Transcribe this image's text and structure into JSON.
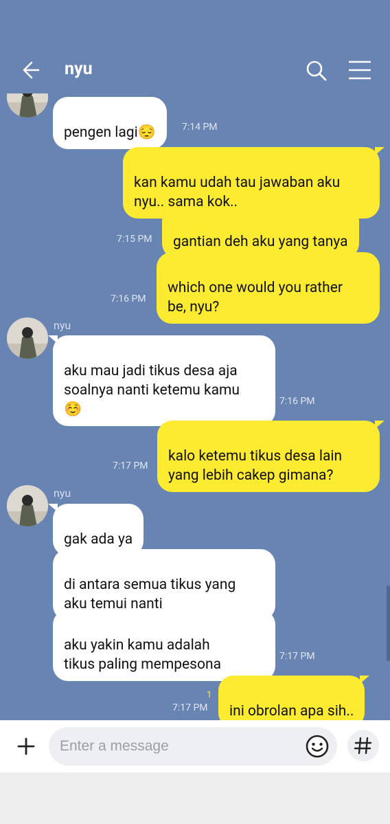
{
  "header": {
    "title": "nyu"
  },
  "messages": [
    {
      "text": "pengen lagi😔",
      "time": "7:14 PM"
    },
    {
      "text": "kan kamu udah tau jawaban aku\nnyu.. sama kok.."
    },
    {
      "text": "gantian deh aku yang tanya",
      "time": "7:15 PM"
    },
    {
      "text": "which one would you rather\nbe, nyu?",
      "time": "7:16 PM"
    },
    {
      "sender": "nyu",
      "text": "aku mau jadi tikus desa aja\nsoalnya nanti ketemu kamu\n☺️",
      "time": "7:16 PM"
    },
    {
      "text": "kalo ketemu tikus desa lain\nyang lebih cakep gimana?",
      "time": "7:17 PM"
    },
    {
      "sender": "nyu",
      "text": "gak ada ya"
    },
    {
      "text": "di antara semua tikus yang\naku temui nanti"
    },
    {
      "text": "aku yakin kamu adalah\ntikus paling mempesona",
      "time": "7:17 PM"
    },
    {
      "text": "ini obrolan apa sih..",
      "time": "7:17 PM",
      "read": "1"
    }
  ],
  "composer": {
    "placeholder": "Enter a message"
  }
}
